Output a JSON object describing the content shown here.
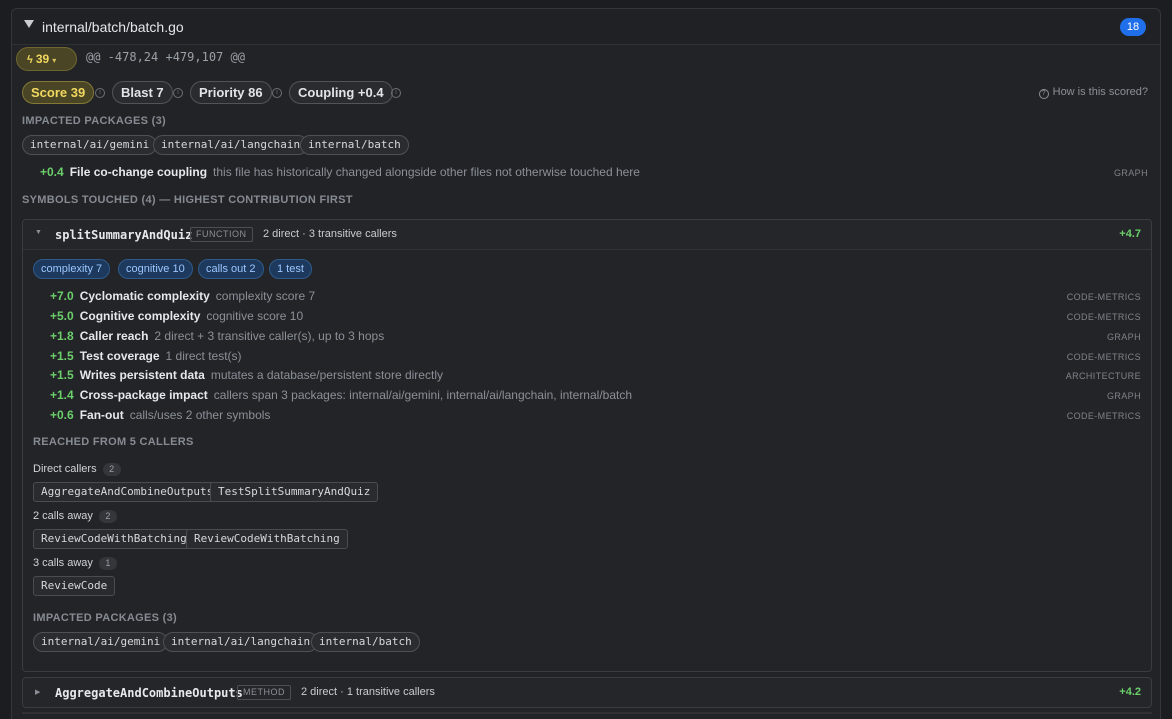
{
  "file": {
    "path": "internal/batch/batch.go",
    "badge_count": "18"
  },
  "score_pill": {
    "icon": "lightning-icon",
    "value": "39",
    "caret": "▾"
  },
  "hunk": "@@ -478,24 +479,107 @@",
  "metrics": [
    {
      "label": "Score 39"
    },
    {
      "label": "Blast 7"
    },
    {
      "label": "Priority 86"
    },
    {
      "label": "Coupling +0.4"
    }
  ],
  "how_scored": "How is this scored?",
  "impacted_packages": {
    "title": "IMPACTED PACKAGES (3)",
    "items": [
      "internal/ai/gemini",
      "internal/ai/langchain",
      "internal/batch"
    ]
  },
  "coupling_row": {
    "delta": "+0.4",
    "title": "File co-change coupling",
    "desc": "this file has historically changed alongside other files not otherwise touched here",
    "source": "GRAPH"
  },
  "symbols_title": "SYMBOLS TOUCHED (4) — HIGHEST CONTRIBUTION FIRST",
  "symbol1": {
    "name": "splitSummaryAndQuiz",
    "kind": "FUNCTION",
    "meta": "2 direct · 3 transitive callers",
    "score": "+4.7",
    "tags": [
      "complexity 7",
      "cognitive 10",
      "calls out 2",
      "1 test"
    ],
    "contributions": [
      {
        "delta": "+7.0",
        "title": "Cyclomatic complexity",
        "desc": "complexity score 7",
        "source": "CODE-METRICS"
      },
      {
        "delta": "+5.0",
        "title": "Cognitive complexity",
        "desc": "cognitive score 10",
        "source": "CODE-METRICS"
      },
      {
        "delta": "+1.8",
        "title": "Caller reach",
        "desc": "2 direct + 3 transitive caller(s), up to 3 hops",
        "source": "GRAPH"
      },
      {
        "delta": "+1.5",
        "title": "Test coverage",
        "desc": "1 direct test(s)",
        "source": "CODE-METRICS"
      },
      {
        "delta": "+1.5",
        "title": "Writes persistent data",
        "desc": "mutates a database/persistent store directly",
        "source": "ARCHITECTURE"
      },
      {
        "delta": "+1.4",
        "title": "Cross-package impact",
        "desc": "callers span 3 packages: internal/ai/gemini, internal/ai/langchain, internal/batch",
        "source": "GRAPH"
      },
      {
        "delta": "+0.6",
        "title": "Fan-out",
        "desc": "calls/uses 2 other symbols",
        "source": "CODE-METRICS"
      }
    ],
    "reached_title": "REACHED FROM 5 CALLERS",
    "caller_groups": [
      {
        "label": "Direct callers",
        "count": "2",
        "callers": [
          "AggregateAndCombineOutputs",
          "TestSplitSummaryAndQuiz"
        ]
      },
      {
        "label": "2 calls away",
        "count": "2",
        "callers": [
          "ReviewCodeWithBatching",
          "ReviewCodeWithBatching"
        ]
      },
      {
        "label": "3 calls away",
        "count": "1",
        "callers": [
          "ReviewCode"
        ]
      }
    ],
    "impacted_title": "IMPACTED PACKAGES (3)",
    "impacted": [
      "internal/ai/gemini",
      "internal/ai/langchain",
      "internal/batch"
    ]
  },
  "symbol2": {
    "name": "AggregateAndCombineOutputs",
    "kind": "METHOD",
    "meta": "2 direct · 1 transitive callers",
    "score": "+4.2"
  }
}
